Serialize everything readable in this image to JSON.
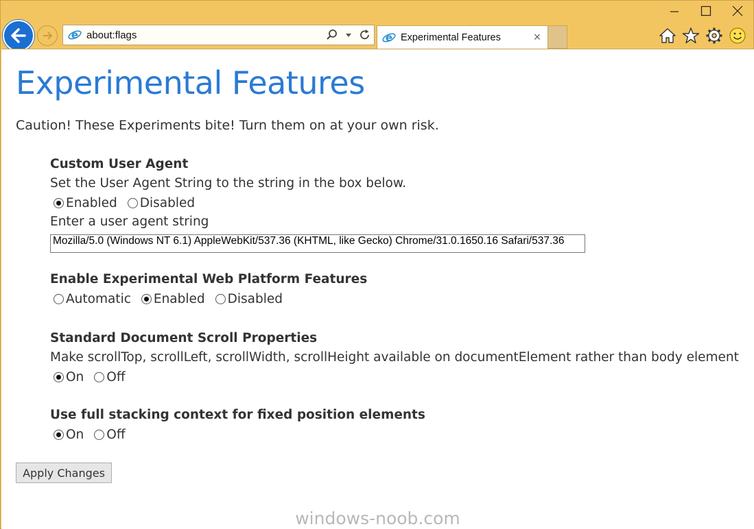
{
  "browser": {
    "address": "about:flags",
    "tab_title": "Experimental Features",
    "tab_close": "×"
  },
  "page": {
    "title": "Experimental Features",
    "caution": "Caution! These Experiments bite! Turn them on at your own risk.",
    "features": [
      {
        "title": "Custom User Agent",
        "description": "Set the User Agent String to the string in the box below.",
        "options": [
          {
            "label": "Enabled",
            "checked": true
          },
          {
            "label": "Disabled",
            "checked": false
          }
        ],
        "input_label": "Enter a user agent string",
        "input_value": "Mozilla/5.0 (Windows NT 6.1) AppleWebKit/537.36 (KHTML, like Gecko) Chrome/31.0.1650.16 Safari/537.36"
      },
      {
        "title": "Enable Experimental Web Platform Features",
        "options": [
          {
            "label": "Automatic",
            "checked": false
          },
          {
            "label": "Enabled",
            "checked": true
          },
          {
            "label": "Disabled",
            "checked": false
          }
        ]
      },
      {
        "title": "Standard Document Scroll Properties",
        "description": "Make scrollTop, scrollLeft, scrollWidth, scrollHeight available on documentElement rather than body element",
        "options": [
          {
            "label": "On",
            "checked": true
          },
          {
            "label": "Off",
            "checked": false
          }
        ]
      },
      {
        "title": "Use full stacking context for fixed position elements",
        "options": [
          {
            "label": "On",
            "checked": true
          },
          {
            "label": "Off",
            "checked": false
          }
        ]
      }
    ],
    "apply_label": "Apply Changes",
    "watermark": "windows-noob.com"
  },
  "icons": {
    "back": "back-arrow-icon",
    "forward": "forward-arrow-icon",
    "search": "search-icon",
    "refresh": "refresh-icon",
    "home": "home-icon",
    "favorites": "star-icon",
    "settings": "gear-icon",
    "feedback": "smiley-icon"
  },
  "colors": {
    "frame": "#f3c560",
    "title_blue": "#2a7bd4",
    "back_button": "#1a6fd1"
  }
}
